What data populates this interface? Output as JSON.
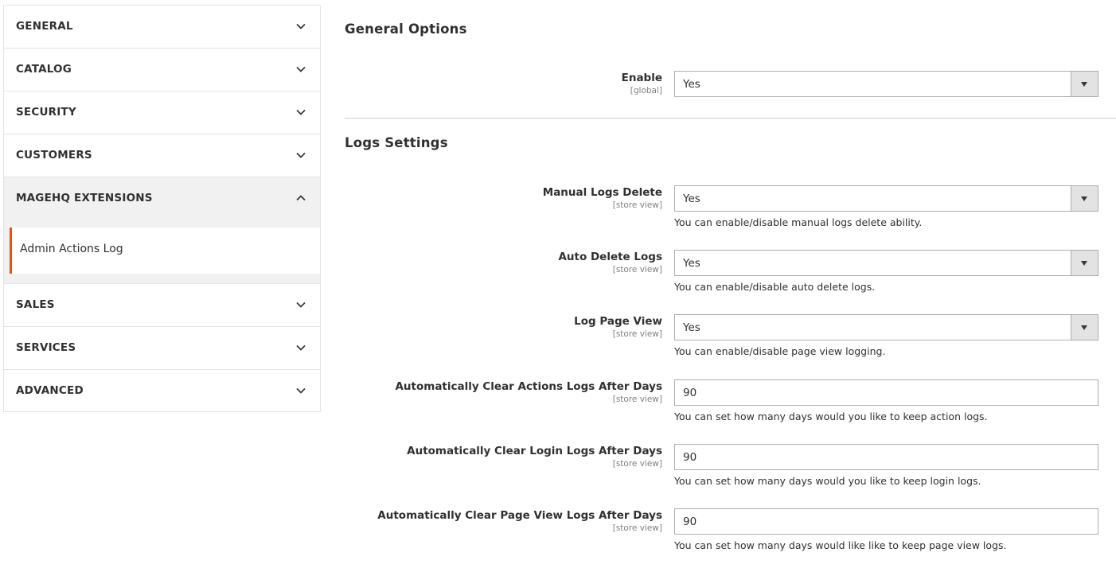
{
  "sidebar": {
    "sections": [
      {
        "label": "GENERAL",
        "open": false
      },
      {
        "label": "CATALOG",
        "open": false
      },
      {
        "label": "SECURITY",
        "open": false
      },
      {
        "label": "CUSTOMERS",
        "open": false
      },
      {
        "label": "MAGEHQ EXTENSIONS",
        "open": true
      },
      {
        "label": "SALES",
        "open": false
      },
      {
        "label": "SERVICES",
        "open": false
      },
      {
        "label": "ADVANCED",
        "open": false
      }
    ],
    "active_item": "Admin Actions Log"
  },
  "general_options": {
    "title": "General Options",
    "enable": {
      "label": "Enable",
      "scope": "[global]",
      "value": "Yes"
    }
  },
  "logs_settings": {
    "title": "Logs Settings",
    "fields": [
      {
        "label": "Manual Logs Delete",
        "scope": "[store view]",
        "value": "Yes",
        "note": "You can enable/disable manual logs delete ability."
      },
      {
        "label": "Auto Delete Logs",
        "scope": "[store view]",
        "value": "Yes",
        "note": "You can enable/disable auto delete logs."
      },
      {
        "label": "Log Page View",
        "scope": "[store view]",
        "value": "Yes",
        "note": "You can enable/disable page view logging."
      },
      {
        "label": "Automatically Clear Actions Logs After Days",
        "scope": "[store view]",
        "value": "90",
        "note": "You can set how many days would you like to keep action logs."
      },
      {
        "label": "Automatically Clear Login Logs After Days",
        "scope": "[store view]",
        "value": "90",
        "note": "You can set how many days would you like to keep login logs."
      },
      {
        "label": "Automatically Clear Page View Logs After Days",
        "scope": "[store view]",
        "value": "90",
        "note": "You can set how many days would like like to keep page view logs."
      }
    ]
  },
  "colors": {
    "accent": "#eb5202",
    "text": "#303030",
    "scope_text": "#808080",
    "border": "#adadad",
    "open_section_bg": "#f1f1f1"
  }
}
